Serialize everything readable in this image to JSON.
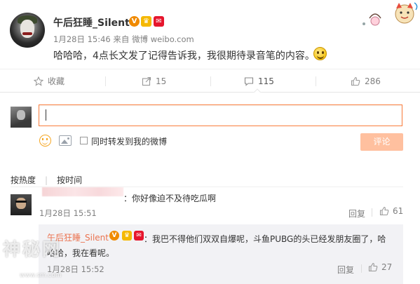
{
  "post": {
    "username": "午后狂睡_Silent",
    "badges": {
      "v": "V",
      "crown": "♛",
      "gift": "✉"
    },
    "time": "1月28日 15:46",
    "source_prefix": "来自",
    "source": "微博 weibo.com",
    "text": "哈哈哈，4点长文发了记得告诉我，我很期待录音笔的内容。"
  },
  "actions": {
    "favorite": {
      "label": "收藏",
      "icon": "star-icon"
    },
    "forward": {
      "count": "15",
      "icon": "forward-icon"
    },
    "comment": {
      "count": "115",
      "icon": "comment-icon"
    },
    "like": {
      "count": "286",
      "icon": "thumbs-up-icon"
    }
  },
  "composer": {
    "input_value": "",
    "also_forward_label": "同时转发到我的微博",
    "submit_label": "评论"
  },
  "sort": {
    "hot": "按热度",
    "time": "按时间"
  },
  "comments": [
    {
      "text": "：你好像迫不及待吃瓜啊",
      "time": "1月28日 15:51",
      "reply_label": "回复",
      "likes": "61",
      "replies": [
        {
          "author": "午后狂睡_Silent",
          "text_line1": "：我巴不得他们双双自爆呢，斗鱼PUBG的头已经发朋友圈了，哈",
          "text_line2": "哈哈，我在看呢。",
          "time": "1月28日 15:52",
          "reply_label": "回复",
          "likes": "27"
        }
      ]
    }
  ],
  "watermark": {
    "main": "神秘网",
    "sub": "www.sm.com"
  },
  "colors": {
    "accent": "#fa7d3c",
    "name_orange": "#eb7350",
    "submit_disabled": "#ffc09f",
    "reply_bg": "#f2f2f5"
  }
}
